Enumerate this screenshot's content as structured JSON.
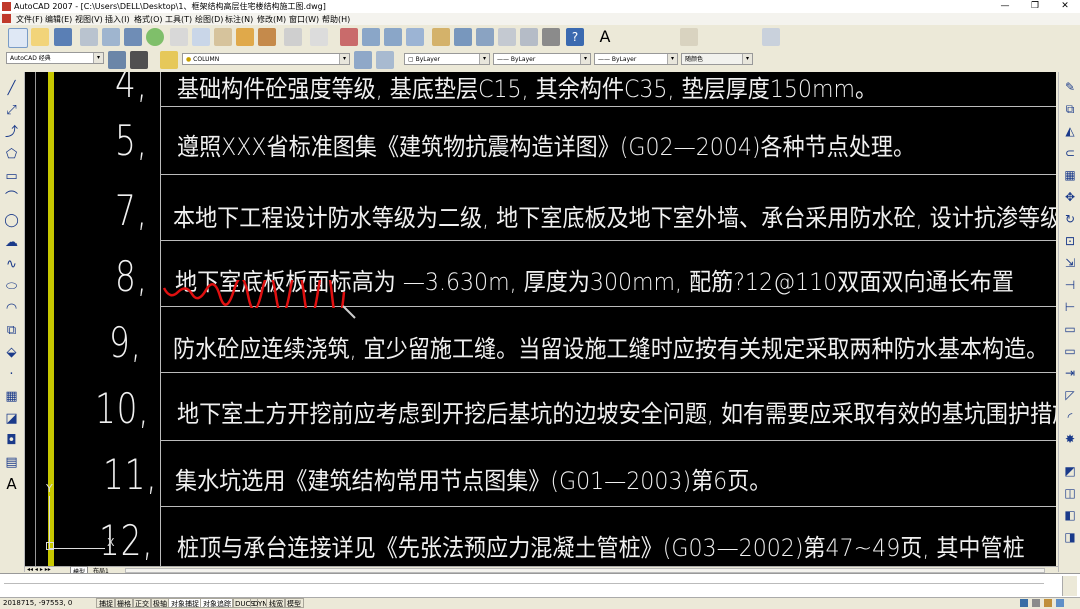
{
  "window": {
    "title": "AutoCAD 2007 - [C:\\Users\\DELL\\Desktop\\1、框架结构高层住宅楼结构施工图.dwg]",
    "controls": [
      "—",
      "❐",
      "✕"
    ]
  },
  "menu": [
    "文件(F)",
    "编辑(E)",
    "视图(V)",
    "插入(I)",
    "格式(O)",
    "工具(T)",
    "绘图(D)",
    "标注(N)",
    "修改(M)",
    "窗口(W)",
    "帮助(H)"
  ],
  "toolbar": {
    "text_style": "STANDARD",
    "dim_style": "NORMAL",
    "table_style": "Standard",
    "workspace": "AutoCAD 经典",
    "layer": "COLUMN",
    "color": "ByLayer",
    "linetype": "ByLayer",
    "lineweight": "ByLayer",
    "plotstyle": "随颜色"
  },
  "drawing": {
    "rows": [
      {
        "num": "4,",
        "text": "基础构件砼强度等级, 基底垫层C15, 其余构件C35, 垫层厚度150mm。"
      },
      {
        "num": "5,",
        "text": "遵照XXX省标准图集《建筑物抗震构造详图》(G02—2004)各种节点处理。"
      },
      {
        "num": "7,",
        "text": "本地下工程设计防水等级为二级, 地下室底板及地下室外墙、承台采用防水砼, 设计抗渗等级为  S6, 具体工程防水"
      },
      {
        "num": "8,",
        "text": "地下室底板板面标高为  —3.630m, 厚度为300mm, 配筋?12@110双面双向通长布置"
      },
      {
        "num": "9,",
        "text": "防水砼应连续浇筑, 宜少留施工缝。当留设施工缝时应按有关规定采取两种防水基本构造。"
      },
      {
        "num": "10,",
        "text": "地下室土方开挖前应考虑到开挖后基坑的边坡安全问题, 如有需要应采取有效的基坑围护措施确保基坑及周围"
      },
      {
        "num": "11,",
        "text": "集水坑选用《建筑结构常用节点图集》(G01—2003)第6页。"
      },
      {
        "num": "12,",
        "text": "桩顶与承台连接详见《先张法预应力混凝土管桩》(G03—2002)第47~49页, 其中管桩"
      }
    ],
    "ucs_x": "X",
    "ucs_y": "Y"
  },
  "tabs": [
    "模型",
    "布局1"
  ],
  "status": {
    "coords": "2018715, -97553, 0",
    "buttons": [
      "捕捉",
      "栅格",
      "正交",
      "极轴",
      "对象捕捉",
      "对象追踪",
      "DUCS",
      "DYN",
      "线宽",
      "模型"
    ]
  }
}
